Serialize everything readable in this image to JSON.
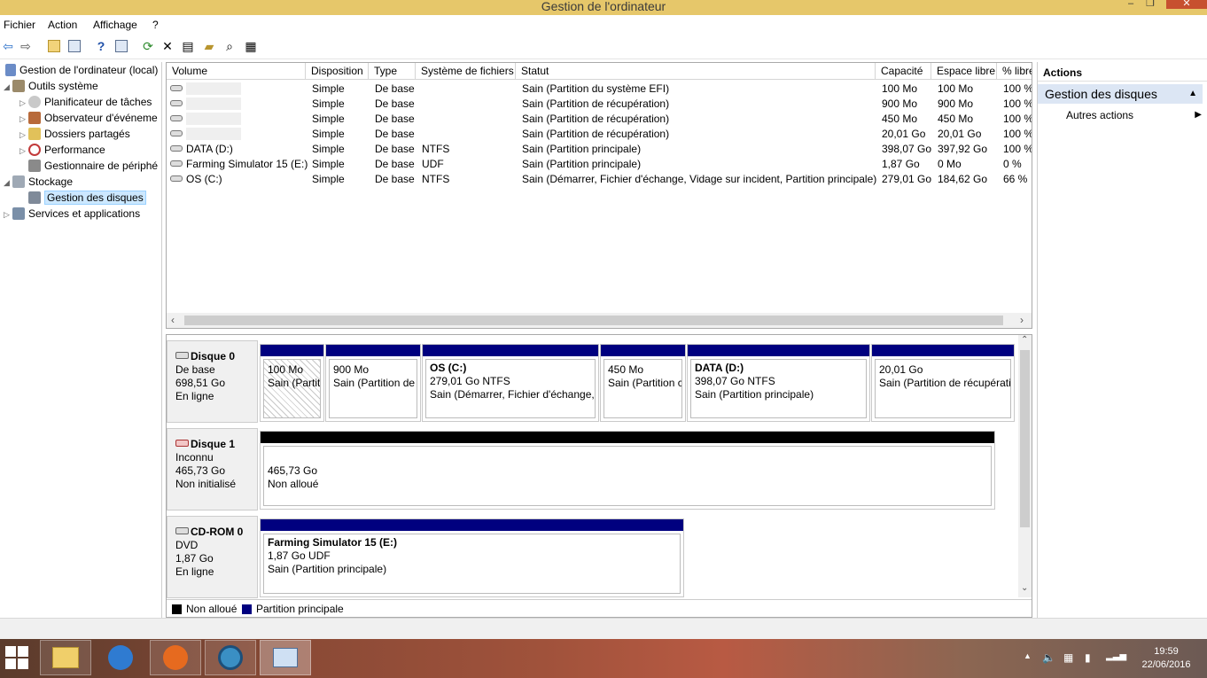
{
  "window": {
    "title": "Gestion de l'ordinateur",
    "minimize": "–",
    "maximize": "❐",
    "close": "✕"
  },
  "menu": [
    "Fichier",
    "Action",
    "Affichage",
    "?"
  ],
  "tree": {
    "items": [
      {
        "label": "Gestion de l'ordinateur (local)",
        "level": 0,
        "expander": ""
      },
      {
        "label": "Outils système",
        "level": 1,
        "expander": "◢"
      },
      {
        "label": "Planificateur de tâches",
        "level": 2,
        "expander": "▷"
      },
      {
        "label": "Observateur d'événeme",
        "level": 2,
        "expander": "▷"
      },
      {
        "label": "Dossiers partagés",
        "level": 2,
        "expander": "▷"
      },
      {
        "label": "Performance",
        "level": 2,
        "expander": "▷"
      },
      {
        "label": "Gestionnaire de périphé",
        "level": 2,
        "expander": ""
      },
      {
        "label": "Stockage",
        "level": 1,
        "expander": "◢"
      },
      {
        "label": "Gestion des disques",
        "level": 2,
        "expander": ""
      },
      {
        "label": "Services et applications",
        "level": 1,
        "expander": "▷"
      }
    ]
  },
  "volumes": {
    "columns": [
      "Volume",
      "Disposition",
      "Type",
      "Système de fichiers",
      "Statut",
      "Capacité",
      "Espace libre",
      "% libre"
    ],
    "rows": [
      [
        "",
        "Simple",
        "De base",
        "",
        "Sain (Partition du système EFI)",
        "100 Mo",
        "100 Mo",
        "100 %"
      ],
      [
        "",
        "Simple",
        "De base",
        "",
        "Sain (Partition de récupération)",
        "900 Mo",
        "900 Mo",
        "100 %"
      ],
      [
        "",
        "Simple",
        "De base",
        "",
        "Sain (Partition de récupération)",
        "450 Mo",
        "450 Mo",
        "100 %"
      ],
      [
        "",
        "Simple",
        "De base",
        "",
        "Sain (Partition de récupération)",
        "20,01 Go",
        "20,01 Go",
        "100 %"
      ],
      [
        "DATA (D:)",
        "Simple",
        "De base",
        "NTFS",
        "Sain (Partition principale)",
        "398,07 Go",
        "397,92 Go",
        "100 %"
      ],
      [
        "Farming Simulator 15 (E:)",
        "Simple",
        "De base",
        "UDF",
        "Sain (Partition principale)",
        "1,87 Go",
        "0 Mo",
        "0 %"
      ],
      [
        "OS (C:)",
        "Simple",
        "De base",
        "NTFS",
        "Sain (Démarrer, Fichier d'échange, Vidage sur incident, Partition principale)",
        "279,01 Go",
        "184,62 Go",
        "66 %"
      ]
    ]
  },
  "disks": [
    {
      "name": "Disque 0",
      "kind": "De base",
      "size": "698,51 Go",
      "state": "En ligne",
      "partitions": [
        {
          "title": "",
          "line1": "100 Mo",
          "line2": "Sain (Partit"
        },
        {
          "title": "",
          "line1": "900 Mo",
          "line2": "Sain (Partition de"
        },
        {
          "title": "OS  (C:)",
          "line1": "279,01 Go NTFS",
          "line2": "Sain (Démarrer, Fichier d'échange, V"
        },
        {
          "title": "",
          "line1": "450 Mo",
          "line2": "Sain (Partition c"
        },
        {
          "title": "DATA  (D:)",
          "line1": "398,07 Go NTFS",
          "line2": "Sain (Partition principale)"
        },
        {
          "title": "",
          "line1": "20,01 Go",
          "line2": "Sain (Partition de récupérati"
        }
      ]
    },
    {
      "name": "Disque 1",
      "kind": "Inconnu",
      "size": "465,73 Go",
      "state": "Non initialisé",
      "partitions": [
        {
          "title": "",
          "line1": "465,73 Go",
          "line2": "Non alloué"
        }
      ]
    },
    {
      "name": "CD-ROM 0",
      "kind": "DVD",
      "size": "1,87 Go",
      "state": "En ligne",
      "partitions": [
        {
          "title": "Farming Simulator 15  (E:)",
          "line1": "1,87 Go UDF",
          "line2": "Sain (Partition principale)"
        }
      ]
    }
  ],
  "legend": [
    {
      "label": "Non alloué",
      "color": "#000000"
    },
    {
      "label": "Partition principale",
      "color": "#00007f"
    }
  ],
  "actions": {
    "header": "Actions",
    "section": "Gestion des disques",
    "item": "Autres actions"
  },
  "taskbar": {
    "time": "19:59",
    "date": "22/06/2016"
  }
}
